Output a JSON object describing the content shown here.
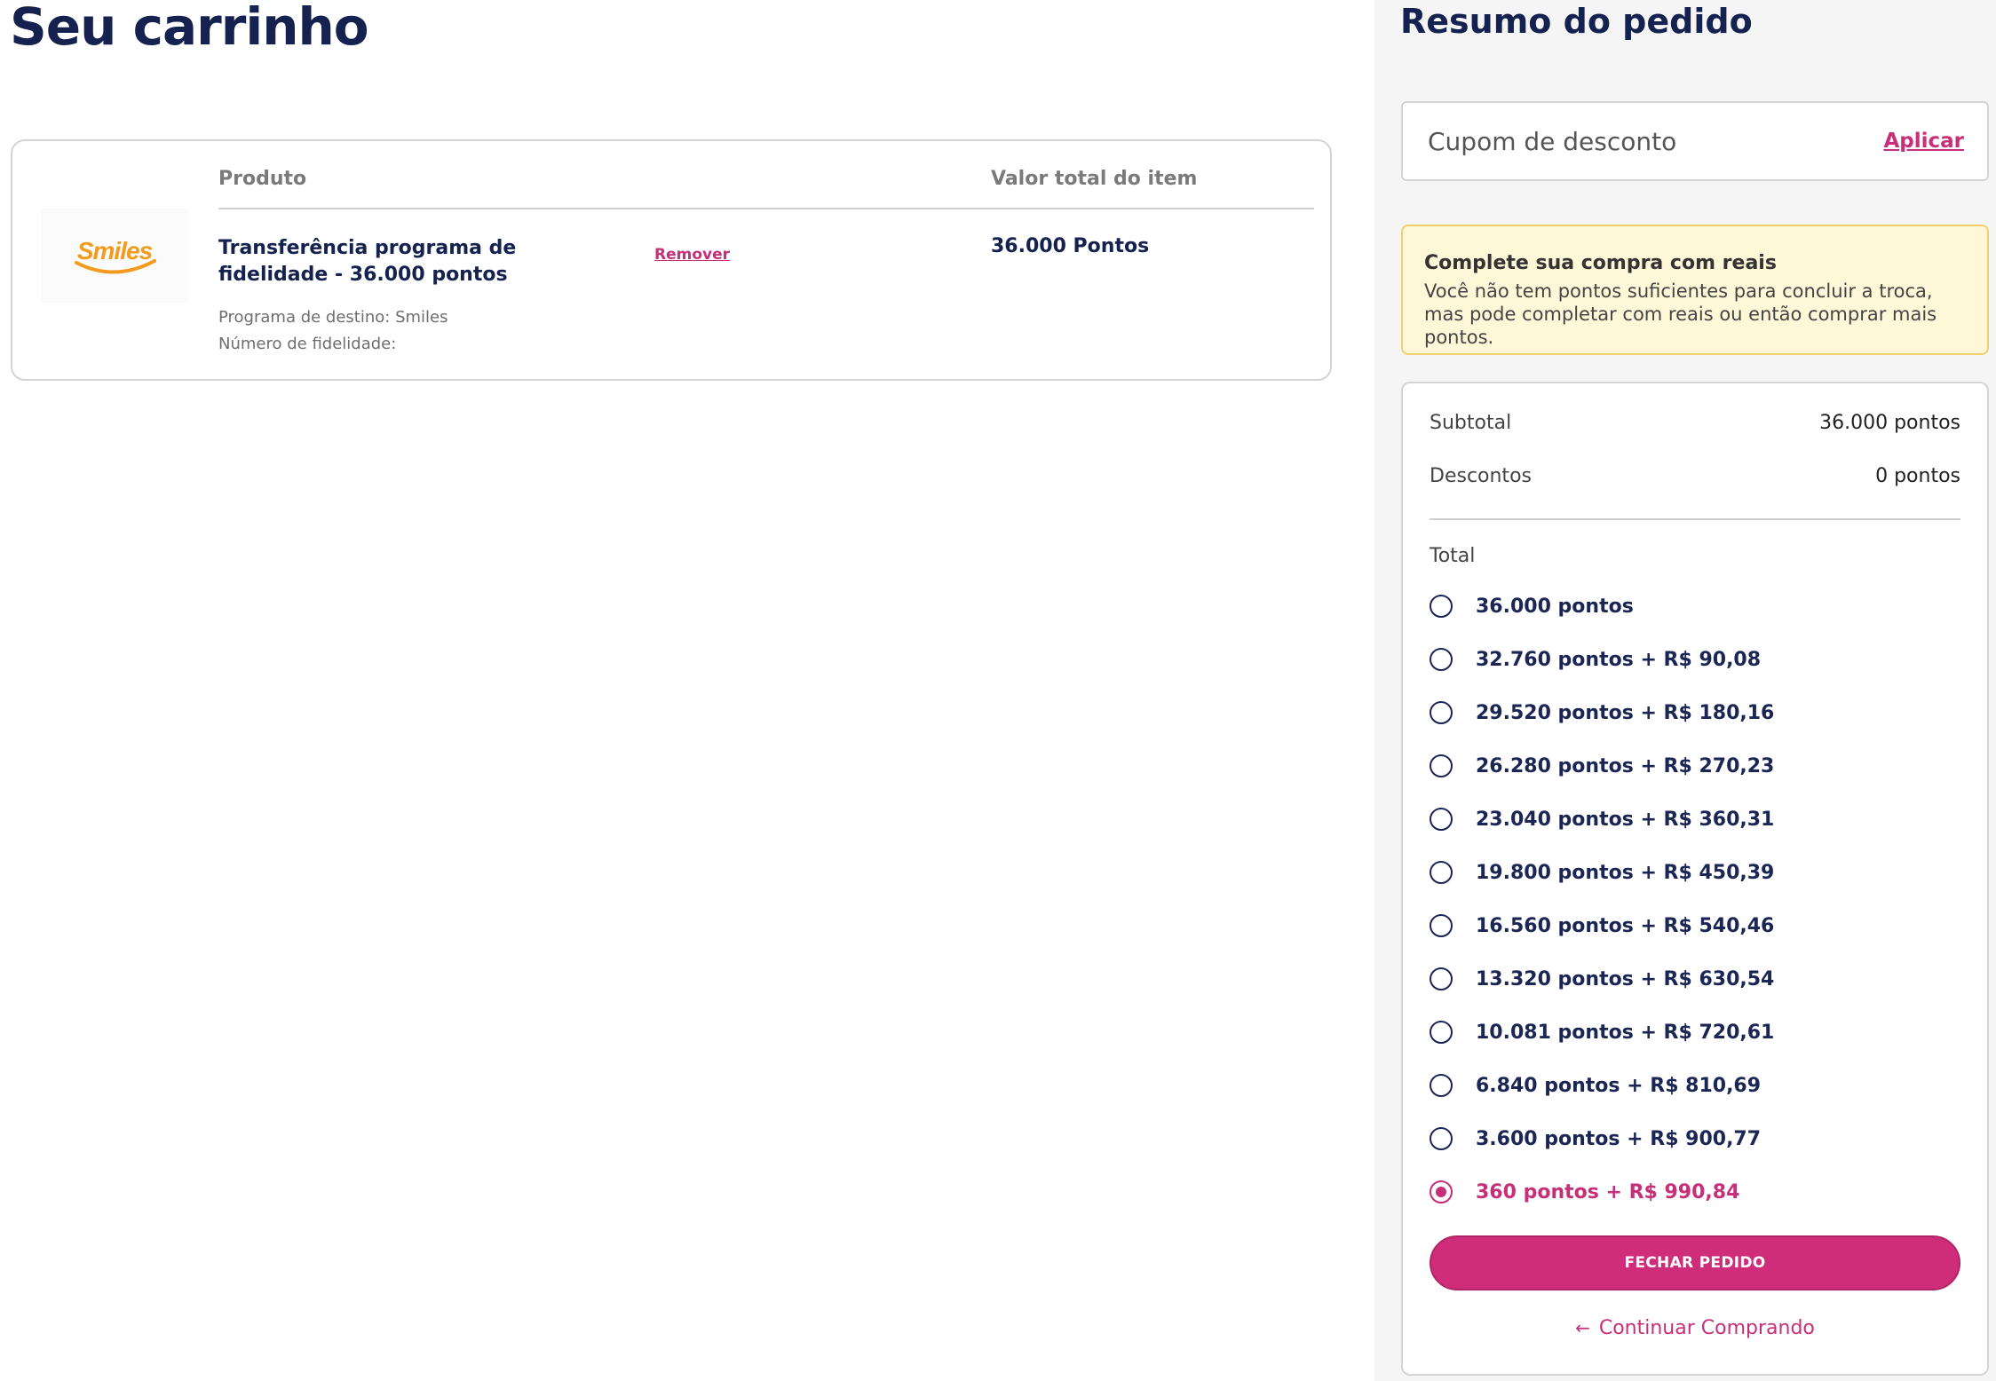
{
  "cart": {
    "title": "Seu carrinho",
    "columns": {
      "product": "Produto",
      "value": "Valor total do item"
    },
    "item": {
      "logo_text": "Smiles",
      "name": "Transferência programa de fidelidade - 36.000 pontos",
      "remove_label": "Remover",
      "total": "36.000 Pontos",
      "destination": "Programa de destino: Smiles",
      "loyalty_number": "Número de fidelidade:"
    }
  },
  "summary": {
    "title": "Resumo do pedido",
    "coupon": {
      "placeholder": "Cupom de desconto",
      "apply_label": "Aplicar"
    },
    "alert": {
      "title": "Complete sua compra com reais",
      "text": "Você não tem pontos suficientes para concluir a troca, mas pode completar com reais ou então comprar mais pontos."
    },
    "subtotal_label": "Subtotal",
    "subtotal_value": "36.000 pontos",
    "discount_label": "Descontos",
    "discount_value": "0 pontos",
    "total_label": "Total",
    "payment_options": [
      "36.000 pontos",
      "32.760 pontos + R$ 90,08",
      "29.520 pontos + R$ 180,16",
      "26.280 pontos + R$ 270,23",
      "23.040 pontos + R$ 360,31",
      "19.800 pontos + R$ 450,39",
      "16.560 pontos + R$ 540,46",
      "13.320 pontos + R$ 630,54",
      "10.081 pontos + R$ 720,61",
      "6.840 pontos + R$ 810,69",
      "3.600 pontos + R$ 900,77",
      "360 pontos + R$ 990,84"
    ],
    "selected_option": 11,
    "checkout_label": "FECHAR PEDIDO",
    "continue_label": "Continuar Comprando"
  },
  "colors": {
    "accent": "#c72f78",
    "navy": "#15224f",
    "smiles_orange": "#f29b1d"
  },
  "icons": {
    "back": "arrow-left-icon",
    "radio": "radio-icon"
  }
}
